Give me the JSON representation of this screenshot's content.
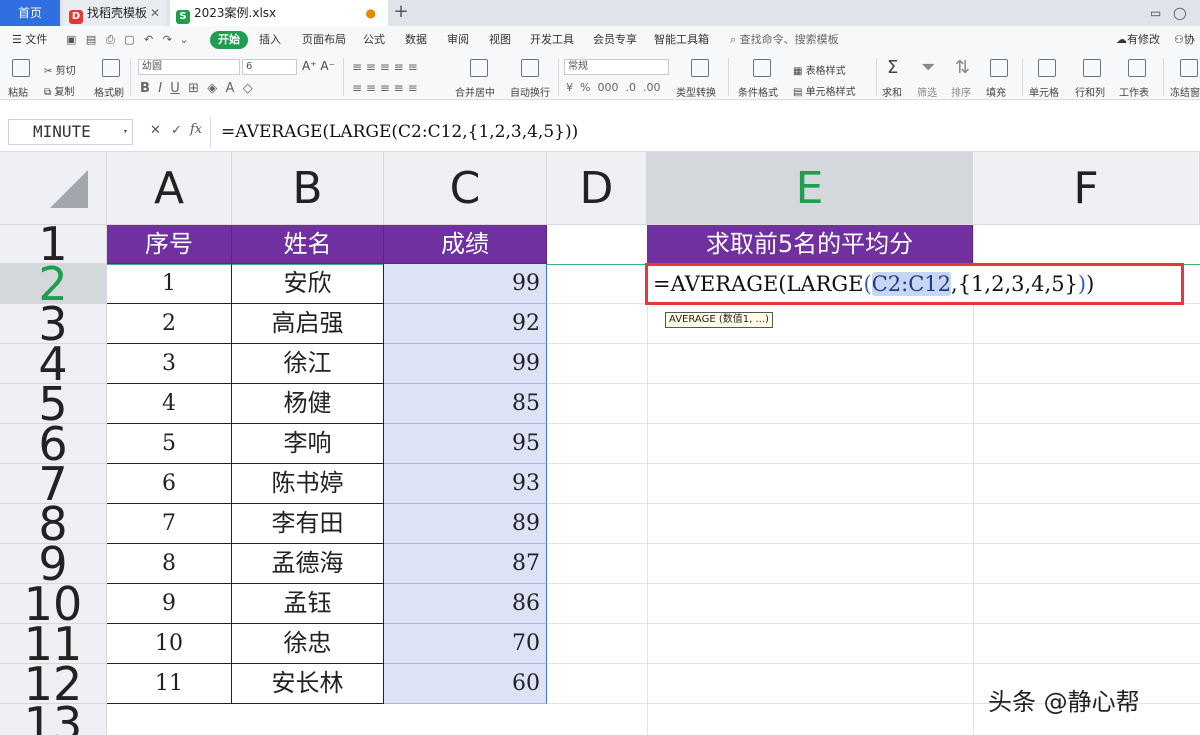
{
  "tabs": {
    "home": "首页",
    "template": "找稻壳模板",
    "file": "2023案例.xlsx",
    "add": "+"
  },
  "menu": {
    "file": "文件",
    "start": "开始",
    "items": [
      "插入",
      "页面布局",
      "公式",
      "数据",
      "审阅",
      "视图",
      "开发工具",
      "会员专享",
      "智能工具箱"
    ],
    "search": "查找命令、搜索模板",
    "modified": "有修改",
    "collab": "协"
  },
  "ribbon": {
    "paste": "粘贴",
    "cut": "剪切",
    "copy": "复制",
    "format_painter": "格式刷",
    "font_name": "幼圆",
    "font_size": "6",
    "merge": "合并居中",
    "wrap": "自动换行",
    "number_format": "常规",
    "type_convert": "类型转换",
    "cond_format": "条件格式",
    "table_style": "表格样式",
    "cell_style": "单元格样式",
    "sum": "求和",
    "filter": "筛选",
    "sort": "排序",
    "fill": "填充",
    "cell": "单元格",
    "row_col": "行和列",
    "sheet": "工作表",
    "freeze": "冻结窗"
  },
  "formula_bar": {
    "name_box": "MINUTE",
    "fx": "fx",
    "formula": "=AVERAGE(LARGE(C2:C12,{1,2,3,4,5}))"
  },
  "columns": [
    "A",
    "B",
    "C",
    "D",
    "E",
    "F"
  ],
  "rows": [
    "1",
    "2",
    "3",
    "4",
    "5",
    "6",
    "7",
    "8",
    "9",
    "10",
    "11",
    "12",
    "13"
  ],
  "table": {
    "headers": [
      "序号",
      "姓名",
      "成绩"
    ],
    "records": [
      {
        "no": "1",
        "name": "安欣",
        "score": "99"
      },
      {
        "no": "2",
        "name": "高启强",
        "score": "92"
      },
      {
        "no": "3",
        "name": "徐江",
        "score": "99"
      },
      {
        "no": "4",
        "name": "杨健",
        "score": "85"
      },
      {
        "no": "5",
        "name": "李响",
        "score": "95"
      },
      {
        "no": "6",
        "name": "陈书婷",
        "score": "93"
      },
      {
        "no": "7",
        "name": "李有田",
        "score": "89"
      },
      {
        "no": "8",
        "name": "孟德海",
        "score": "87"
      },
      {
        "no": "9",
        "name": "孟钰",
        "score": "86"
      },
      {
        "no": "10",
        "name": "徐忠",
        "score": "70"
      },
      {
        "no": "11",
        "name": "安长林",
        "score": "60"
      }
    ]
  },
  "e_column": {
    "header": "求取前5名的平均分",
    "edit_prefix": "=AVERAGE(LARGE",
    "edit_paren_open": "(",
    "edit_ref": "C2:C12",
    "edit_mid": ",{1,2,3,4,5}",
    "edit_paren_close": ")",
    "edit_end": ")",
    "tooltip": "AVERAGE (数值1, ...)"
  },
  "watermark": "头条 @静心帮",
  "colors": {
    "header_fill": "#7030a0",
    "selection_fill": "#dce3f7",
    "edit_border": "#e53935",
    "active_green": "#1e9e4e"
  }
}
